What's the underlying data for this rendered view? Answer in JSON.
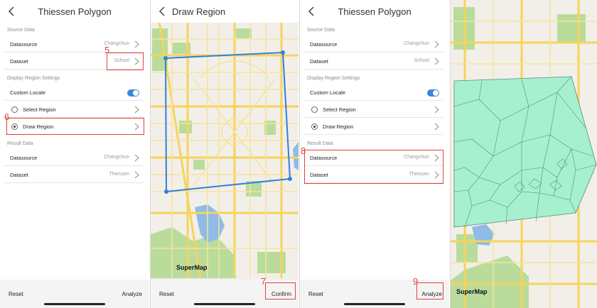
{
  "panel1": {
    "title": "Thiessen Polygon",
    "source_section": "Source Data",
    "source_datasource_label": "Datasource",
    "source_datasource_value": "Changchun",
    "source_dataset_label": "Dataset",
    "source_dataset_value": "School",
    "region_section": "Display Region Settings",
    "custom_locale_label": "Custom Locale",
    "custom_locale_on": true,
    "select_region_label": "Select Region",
    "draw_region_label": "Draw Region",
    "selected_region": "Draw Region",
    "result_section": "Result Data",
    "result_datasource_label": "Datasource",
    "result_datasource_value": "Changchun",
    "result_dataset_label": "Dataset",
    "result_dataset_value": "Thiessen",
    "reset_label": "Reset",
    "analyze_label": "Analyze"
  },
  "panel2": {
    "title": "Draw Region",
    "brand": "SuperMap",
    "reset_label": "Reset",
    "confirm_label": "Confirm"
  },
  "panel3": {
    "title": "Thiessen Polygon",
    "source_section": "Source Data",
    "source_datasource_label": "Datasource",
    "source_datasource_value": "Changchun",
    "source_dataset_label": "Dataset",
    "source_dataset_value": "School",
    "region_section": "Display Region Settings",
    "custom_locale_label": "Custom Locale",
    "custom_locale_on": true,
    "select_region_label": "Select Region",
    "draw_region_label": "Draw Region",
    "selected_region": "Draw Region",
    "result_section": "Result Data",
    "result_datasource_label": "Datasource",
    "result_datasource_value": "Changchun",
    "result_dataset_label": "Dataset",
    "result_dataset_value": "Thiessen",
    "reset_label": "Reset",
    "analyze_label": "Analyze"
  },
  "panel4": {
    "brand": "SuperMap"
  },
  "steps": {
    "s5": "5",
    "s6": "6",
    "s7": "7",
    "s8": "8",
    "s9": "9"
  },
  "colors": {
    "annotation_red": "#e0443b",
    "toggle_blue": "#3a86d8",
    "draw_line_blue": "#2f7fe0",
    "voronoi_fill": "#a6f0cf",
    "voronoi_stroke": "#5a8a74",
    "map_base": "#f2efe9",
    "park_green": "#b9dc9c",
    "water_blue": "#8fbbe6",
    "road_yellow": "#f6d35b"
  },
  "icons": {
    "back": "chevron-left-icon",
    "row_arrow": "chevron-right-icon"
  }
}
